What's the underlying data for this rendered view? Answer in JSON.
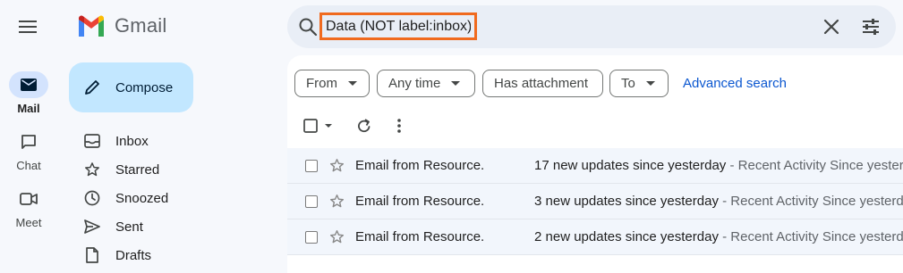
{
  "app": {
    "logo_text": "Gmail"
  },
  "rail": [
    {
      "label": "Mail",
      "icon": "mail-icon",
      "active": true
    },
    {
      "label": "Chat",
      "icon": "chat-icon",
      "active": false
    },
    {
      "label": "Meet",
      "icon": "meet-icon",
      "active": false
    }
  ],
  "compose": {
    "label": "Compose"
  },
  "nav": [
    {
      "label": "Inbox",
      "icon": "inbox-icon"
    },
    {
      "label": "Starred",
      "icon": "star-icon"
    },
    {
      "label": "Snoozed",
      "icon": "clock-icon"
    },
    {
      "label": "Sent",
      "icon": "send-icon"
    },
    {
      "label": "Drafts",
      "icon": "draft-icon"
    }
  ],
  "search": {
    "query": "Data (NOT label:inbox)"
  },
  "filters": {
    "from": "From",
    "time": "Any time",
    "attachment": "Has attachment",
    "to": "To",
    "advanced": "Advanced search"
  },
  "emails": [
    {
      "sender": "Email from Resource.",
      "subject": "17 new updates since yesterday",
      "snippet": " - Recent Activity Since yesterday"
    },
    {
      "sender": "Email from Resource.",
      "subject": "3 new updates since yesterday",
      "snippet": " - Recent Activity Since yesterday"
    },
    {
      "sender": "Email from Resource.",
      "subject": "2 new updates since yesterday",
      "snippet": " - Recent Activity Since yesterday"
    }
  ],
  "colors": {
    "accent": "#0b57d0",
    "highlight_border": "#f06a1e",
    "compose_bg": "#c2e7ff",
    "active_rail": "#d3e3fd"
  }
}
